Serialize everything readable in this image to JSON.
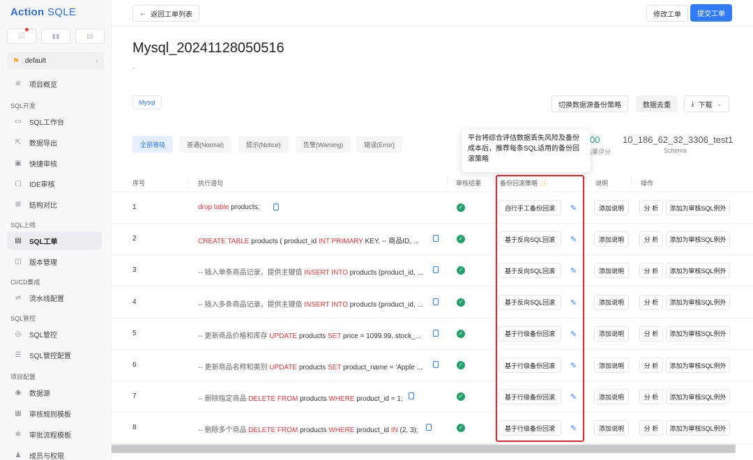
{
  "brand": {
    "left": "Action",
    "right": "SQLE"
  },
  "project": {
    "name": "default"
  },
  "nav": {
    "overview": "项目概览",
    "groups": [
      "SQL开发",
      "SQL上线",
      "CI/CD集成",
      "SQL管控",
      "项目配置"
    ],
    "items": [
      "SQL工作台",
      "数据导出",
      "快捷审核",
      "IDE审核",
      "结构对比",
      "SQL工单",
      "版本管理",
      "流水线配置",
      "SQL管控",
      "SQL管控配置",
      "数据源",
      "审核规则模板",
      "审批流程模板",
      "成员与权限"
    ]
  },
  "topbar": {
    "back": "返回工单列表",
    "modify": "修改工单",
    "submit": "提交工单"
  },
  "ticket": {
    "title": "Mysql_20241128050516",
    "subtitle": "-",
    "db_tag": "Mysql"
  },
  "actions": {
    "switch": "切换数据源备份策略",
    "dedupe": "数据去重",
    "download": "下载"
  },
  "levels": [
    "全部等级",
    "普通(Normal)",
    "提示(Notice)",
    "告警(Warning)",
    "错误(Error)"
  ],
  "stats": {
    "score_value": "00",
    "score_label": "结果评分",
    "schema_value": "10_186_62_32_3306_test1",
    "schema_label": "Schema"
  },
  "tooltip": "平台将综合评估数据丢失风险及备份成本后，推荐每条SQL适用的备份回滚策略",
  "table": {
    "headers": [
      "序号",
      "执行语句",
      "审核结果",
      "备份回滚策略",
      "说明",
      "操作"
    ],
    "add_desc": "添加说明",
    "analyze": "分 析",
    "exception": "添加为审核SQL例外",
    "rows": [
      {
        "no": "1",
        "stmt": [
          {
            "t": "drop table",
            "k": "kw"
          },
          {
            "t": " products;",
            "k": ""
          }
        ],
        "strategy": "自行手工备份回滚"
      },
      {
        "no": "2",
        "stmt": [
          {
            "t": "CREATE TABLE",
            "k": "kw"
          },
          {
            "t": " products ( product_id ",
            "k": ""
          },
          {
            "t": "INT PRIMARY",
            "k": "kw"
          },
          {
            "t": " KEY, -- 商品ID, ...",
            "k": ""
          }
        ],
        "strategy": "基于反向SQL回滚"
      },
      {
        "no": "3",
        "stmt": [
          {
            "t": "-- 插入单条商品记录，提供主键值 ",
            "k": "cm"
          },
          {
            "t": "INSERT INTO",
            "k": "kw"
          },
          {
            "t": " products (product_id, ...",
            "k": ""
          }
        ],
        "strategy": "基于反向SQL回滚"
      },
      {
        "no": "4",
        "stmt": [
          {
            "t": "-- 插入多条商品记录，提供主键值 ",
            "k": "cm"
          },
          {
            "t": "INSERT INTO",
            "k": "kw"
          },
          {
            "t": " products (product_id, ...",
            "k": ""
          }
        ],
        "strategy": "基于反向SQL回滚"
      },
      {
        "no": "5",
        "stmt": [
          {
            "t": "-- 更新商品价格和库存 ",
            "k": "cm"
          },
          {
            "t": "UPDATE",
            "k": "kw"
          },
          {
            "t": " products ",
            "k": ""
          },
          {
            "t": "SET",
            "k": "kw"
          },
          {
            "t": " price = 1099.99, stock_...",
            "k": ""
          }
        ],
        "strategy": "基于行级备份回滚"
      },
      {
        "no": "6",
        "stmt": [
          {
            "t": "-- 更新商品名称和类别 ",
            "k": "cm"
          },
          {
            "t": "UPDATE",
            "k": "kw"
          },
          {
            "t": " products ",
            "k": ""
          },
          {
            "t": "SET",
            "k": "kw"
          },
          {
            "t": " product_name = 'Apple ...",
            "k": ""
          }
        ],
        "strategy": "基于行级备份回滚"
      },
      {
        "no": "7",
        "stmt": [
          {
            "t": "-- 删除指定商品 ",
            "k": "cm"
          },
          {
            "t": "DELETE FROM",
            "k": "kw"
          },
          {
            "t": " products ",
            "k": ""
          },
          {
            "t": "WHERE",
            "k": "kw"
          },
          {
            "t": " product_id = 1;",
            "k": ""
          }
        ],
        "strategy": "基于行级备份回滚"
      },
      {
        "no": "8",
        "stmt": [
          {
            "t": "-- 删除多个商品 ",
            "k": "cm"
          },
          {
            "t": "DELETE FROM",
            "k": "kw"
          },
          {
            "t": " products ",
            "k": ""
          },
          {
            "t": "WHERE",
            "k": "kw"
          },
          {
            "t": " product_id ",
            "k": ""
          },
          {
            "t": "IN",
            "k": "kw"
          },
          {
            "t": " (2, 3);",
            "k": ""
          }
        ],
        "strategy": "基于行级备份回滚"
      }
    ]
  },
  "colors": {
    "primary": "#2f7cf6",
    "keyword": "#e03a3a",
    "success": "#22a06b",
    "highlight": "#e0282e"
  }
}
